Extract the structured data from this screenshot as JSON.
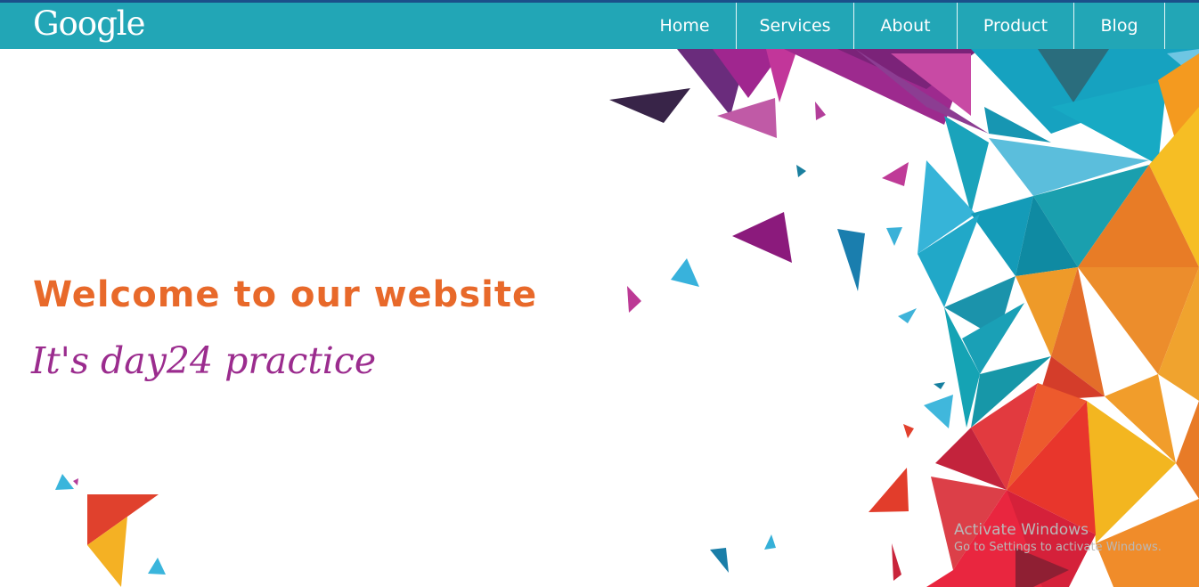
{
  "brand": {
    "logo_text": "Google"
  },
  "nav": {
    "items": [
      "Home",
      "Services",
      "About",
      "Product",
      "Blog"
    ]
  },
  "hero": {
    "headline": "Welcome to our website",
    "subline": "It's day24 practice"
  },
  "watermark": {
    "title": "Activate Windows",
    "subtitle": "Go to Settings to activate Windows."
  },
  "colors": {
    "navbar": "#22a6b6",
    "headline": "#e8692a",
    "subline": "#9b2c8e"
  }
}
